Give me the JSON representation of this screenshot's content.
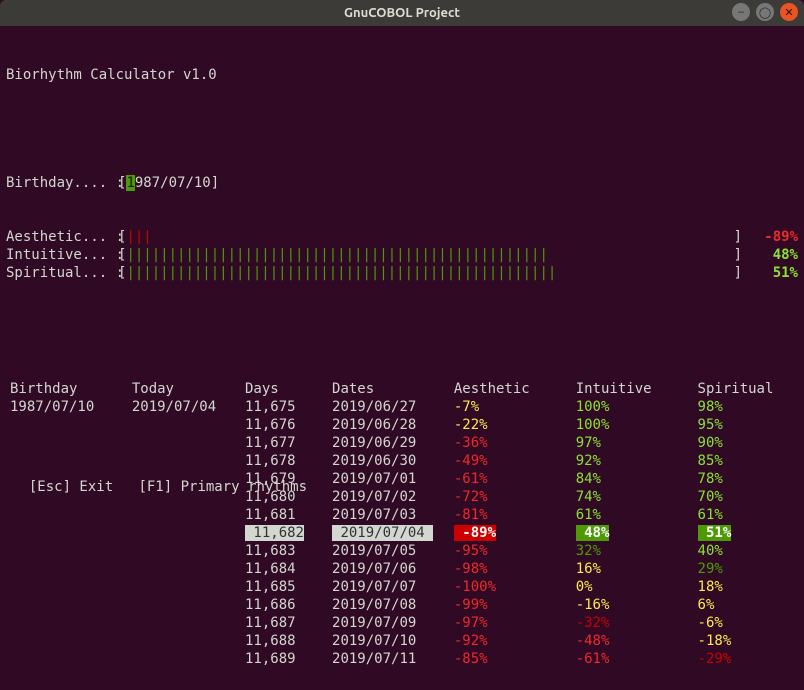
{
  "window": {
    "title": "GnuCOBOL Project"
  },
  "header": {
    "title": "Biorhythm Calculator v1.0"
  },
  "input": {
    "label": "Birthday.... : ",
    "value": "1987/07/10"
  },
  "bars": [
    {
      "label": "Aesthetic... : ",
      "color": "red",
      "fill": 3,
      "pct": "-89%",
      "cls": "red-b"
    },
    {
      "label": "Intuitive... : ",
      "color": "green",
      "fill": 50,
      "pct": "48%",
      "cls": "green-b"
    },
    {
      "label": "Spiritual... : ",
      "color": "green",
      "fill": 51,
      "pct": "51%",
      "cls": "green-b"
    }
  ],
  "columns": [
    "Birthday",
    "Today",
    "Days",
    "Dates",
    "Aesthetic",
    "Intuitive",
    "Spiritual"
  ],
  "first": {
    "birthday": "1987/07/10",
    "today": "2019/07/04"
  },
  "rows": [
    {
      "days": "11,675",
      "date": "2019/06/27",
      "aes": "-7%",
      "aesC": "yellow-b",
      "int": "100%",
      "intC": "green-b",
      "spi": "98%",
      "spiC": "green-b"
    },
    {
      "days": "11,676",
      "date": "2019/06/28",
      "aes": "-22%",
      "aesC": "yellow-b",
      "int": "100%",
      "intC": "green-b",
      "spi": "95%",
      "spiC": "green-b"
    },
    {
      "days": "11,677",
      "date": "2019/06/29",
      "aes": "-36%",
      "aesC": "red-b",
      "int": "97%",
      "intC": "green-b",
      "spi": "90%",
      "spiC": "green-b"
    },
    {
      "days": "11,678",
      "date": "2019/06/30",
      "aes": "-49%",
      "aesC": "red-b",
      "int": "92%",
      "intC": "green-b",
      "spi": "85%",
      "spiC": "green-b"
    },
    {
      "days": "11,679",
      "date": "2019/07/01",
      "aes": "-61%",
      "aesC": "red-b",
      "int": "84%",
      "intC": "green-b",
      "spi": "78%",
      "spiC": "green-b"
    },
    {
      "days": "11,680",
      "date": "2019/07/02",
      "aes": "-72%",
      "aesC": "red-b",
      "int": "74%",
      "intC": "green-b",
      "spi": "70%",
      "spiC": "green-b"
    },
    {
      "days": "11,681",
      "date": "2019/07/03",
      "aes": "-81%",
      "aesC": "red-b",
      "int": "61%",
      "intC": "green-b",
      "spi": "61%",
      "spiC": "green-b"
    },
    {
      "days": "11,682",
      "date": "2019/07/04",
      "aes": "-89%",
      "aesC": "red-b",
      "int": "48%",
      "intC": "green-b",
      "spi": "51%",
      "spiC": "green-b",
      "hl": true
    },
    {
      "days": "11,683",
      "date": "2019/07/05",
      "aes": "-95%",
      "aesC": "red-b",
      "int": "32%",
      "intC": "dim-green",
      "spi": "40%",
      "spiC": "green-b"
    },
    {
      "days": "11,684",
      "date": "2019/07/06",
      "aes": "-98%",
      "aesC": "red-b",
      "int": "16%",
      "intC": "yellow-b",
      "spi": "29%",
      "spiC": "dim-green"
    },
    {
      "days": "11,685",
      "date": "2019/07/07",
      "aes": "-100%",
      "aesC": "red-b",
      "int": "0%",
      "intC": "yellow-b",
      "spi": "18%",
      "spiC": "yellow-b"
    },
    {
      "days": "11,686",
      "date": "2019/07/08",
      "aes": "-99%",
      "aesC": "red-b",
      "int": "-16%",
      "intC": "yellow-b",
      "spi": "6%",
      "spiC": "yellow-b"
    },
    {
      "days": "11,687",
      "date": "2019/07/09",
      "aes": "-97%",
      "aesC": "red-b",
      "int": "-32%",
      "intC": "dim-red",
      "spi": "-6%",
      "spiC": "yellow-b"
    },
    {
      "days": "11,688",
      "date": "2019/07/10",
      "aes": "-92%",
      "aesC": "red-b",
      "int": "-48%",
      "intC": "red-b",
      "spi": "-18%",
      "spiC": "yellow-b"
    },
    {
      "days": "11,689",
      "date": "2019/07/11",
      "aes": "-85%",
      "aesC": "red-b",
      "int": "-61%",
      "intC": "red-b",
      "spi": "-29%",
      "spiC": "dim-red"
    }
  ],
  "footer": {
    "esc": "[Esc] Exit",
    "f1": "[F1] Primary rhythms"
  },
  "barWidth": 67
}
